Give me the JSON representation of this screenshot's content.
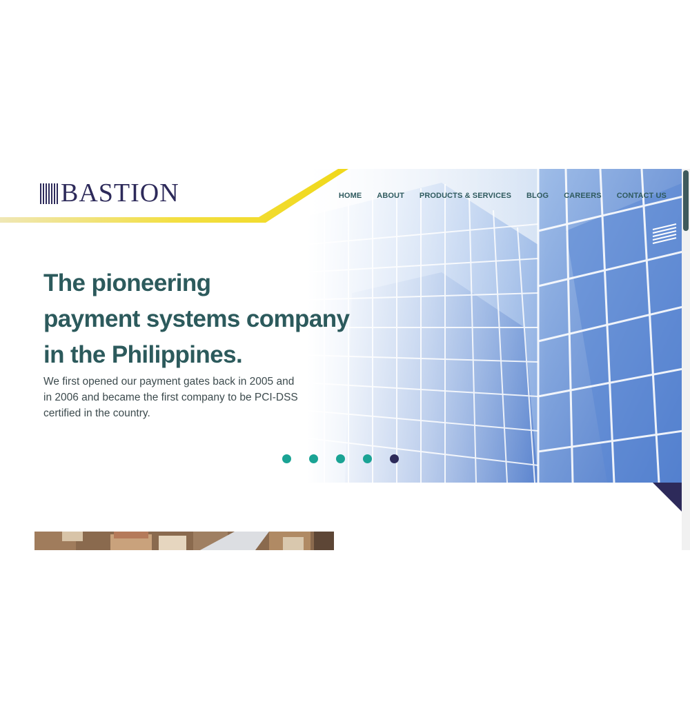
{
  "brand": {
    "name": "BASTION",
    "color": "#2d2a5a",
    "accent": "#f0d81a"
  },
  "nav": {
    "items": [
      {
        "label": "HOME"
      },
      {
        "label": "ABOUT"
      },
      {
        "label": "PRODUCTS & SERVICES"
      },
      {
        "label": "BLOG"
      },
      {
        "label": "CAREERS"
      },
      {
        "label": "CONTACT US"
      }
    ],
    "menu_icon": "hamburger-lines-icon"
  },
  "hero": {
    "headline_lines": [
      "The pioneering",
      "payment systems company",
      "in the Philippines."
    ],
    "subtext": "We first opened our payment gates back in 2005 and in 2006 and became the first company to be PCI-DSS certified in the country.",
    "slides": {
      "count": 5,
      "active_index": 4
    },
    "colors": {
      "headline": "#2c5a5c",
      "dot": "#1aa394",
      "dot_active": "#2d2a5a"
    }
  },
  "scrollbar": {
    "position_fraction": 0.0
  }
}
